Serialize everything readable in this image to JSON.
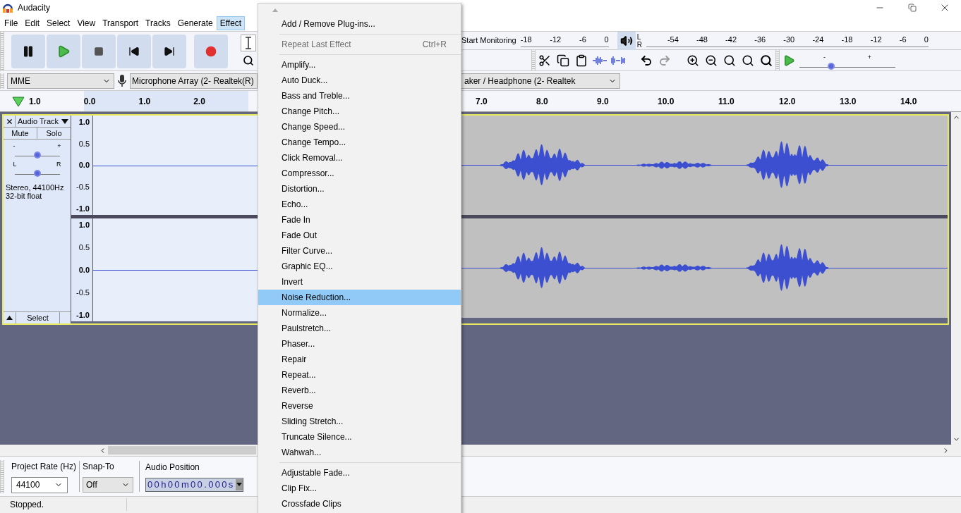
{
  "window": {
    "title": "Audacity"
  },
  "menu_bar": [
    {
      "label": "File",
      "selected": false
    },
    {
      "label": "Edit",
      "selected": false
    },
    {
      "label": "Select",
      "selected": false
    },
    {
      "label": "View",
      "selected": false
    },
    {
      "label": "Transport",
      "selected": false
    },
    {
      "label": "Tracks",
      "selected": false
    },
    {
      "label": "Generate",
      "selected": false
    },
    {
      "label": "Effect",
      "selected": true
    }
  ],
  "record_meter": {
    "button": "Start Monitoring",
    "ticks": [
      "-18",
      "-12",
      "-6",
      "0"
    ]
  },
  "playback_meter": {
    "channels": [
      "L",
      "R"
    ],
    "ticks": [
      "-54",
      "-48",
      "-42",
      "-36",
      "-30",
      "-24",
      "-18",
      "-12",
      "-6",
      "0"
    ]
  },
  "play_at_speed": {
    "min": "-",
    "max": "+",
    "level": 0.33
  },
  "device_bar": {
    "host": "MME",
    "recording_device": "Microphone Array (2- Realtek(R)",
    "playback_device": "aker / Headphone (2- Realtek"
  },
  "timeline": {
    "left_labels": [
      "1.0",
      "0.0",
      "1.0",
      "2.0"
    ],
    "right_labels": [
      "7.0",
      "8.0",
      "9.0",
      "10.0",
      "11.0",
      "12.0",
      "13.0",
      "14.0"
    ]
  },
  "track": {
    "name": "Audio Track",
    "mute": "Mute",
    "solo": "Solo",
    "gain": {
      "min": "-",
      "max": "+",
      "level": 0.5
    },
    "pan": {
      "min": "L",
      "max": "R",
      "level": 0.5
    },
    "info": [
      "Stereo, 44100Hz",
      "32-bit float"
    ],
    "select": "Select",
    "channels": [
      {
        "scale": [
          "1.0",
          "0.5",
          "0.0",
          "-0.5",
          "-1.0"
        ]
      },
      {
        "scale": [
          "1.0",
          "0.5",
          "0.0",
          "-0.5",
          "-1.0"
        ]
      }
    ]
  },
  "selection_bar": {
    "project_rate_label": "Project Rate (Hz)",
    "project_rate": "44100",
    "snap_to_label": "Snap-To",
    "snap_to": "Off",
    "audio_position_label": "Audio Position",
    "audio_position": "00h00m00.000s"
  },
  "status_bar": {
    "text": "Stopped."
  },
  "effect_menu": {
    "items": [
      {
        "kind": "item",
        "label": "Add / Remove Plug-ins...",
        "disabled": false,
        "selected": false
      },
      {
        "kind": "separator"
      },
      {
        "kind": "item",
        "label": "Repeat Last Effect",
        "shortcut": "Ctrl+R",
        "disabled": true,
        "selected": false
      },
      {
        "kind": "separator"
      },
      {
        "kind": "item",
        "label": "Amplify...",
        "disabled": false,
        "selected": false
      },
      {
        "kind": "item",
        "label": "Auto Duck...",
        "disabled": false,
        "selected": false
      },
      {
        "kind": "item",
        "label": "Bass and Treble...",
        "disabled": false,
        "selected": false
      },
      {
        "kind": "item",
        "label": "Change Pitch...",
        "disabled": false,
        "selected": false
      },
      {
        "kind": "item",
        "label": "Change Speed...",
        "disabled": false,
        "selected": false
      },
      {
        "kind": "item",
        "label": "Change Tempo...",
        "disabled": false,
        "selected": false
      },
      {
        "kind": "item",
        "label": "Click Removal...",
        "disabled": false,
        "selected": false
      },
      {
        "kind": "item",
        "label": "Compressor...",
        "disabled": false,
        "selected": false
      },
      {
        "kind": "item",
        "label": "Distortion...",
        "disabled": false,
        "selected": false
      },
      {
        "kind": "item",
        "label": "Echo...",
        "disabled": false,
        "selected": false
      },
      {
        "kind": "item",
        "label": "Fade In",
        "disabled": false,
        "selected": false
      },
      {
        "kind": "item",
        "label": "Fade Out",
        "disabled": false,
        "selected": false
      },
      {
        "kind": "item",
        "label": "Filter Curve...",
        "disabled": false,
        "selected": false
      },
      {
        "kind": "item",
        "label": "Graphic EQ...",
        "disabled": false,
        "selected": false
      },
      {
        "kind": "item",
        "label": "Invert",
        "disabled": false,
        "selected": false
      },
      {
        "kind": "item",
        "label": "Noise Reduction...",
        "disabled": false,
        "selected": true
      },
      {
        "kind": "item",
        "label": "Normalize...",
        "disabled": false,
        "selected": false
      },
      {
        "kind": "item",
        "label": "Paulstretch...",
        "disabled": false,
        "selected": false
      },
      {
        "kind": "item",
        "label": "Phaser...",
        "disabled": false,
        "selected": false
      },
      {
        "kind": "item",
        "label": "Repair",
        "disabled": false,
        "selected": false
      },
      {
        "kind": "item",
        "label": "Repeat...",
        "disabled": false,
        "selected": false
      },
      {
        "kind": "item",
        "label": "Reverb...",
        "disabled": false,
        "selected": false
      },
      {
        "kind": "item",
        "label": "Reverse",
        "disabled": false,
        "selected": false
      },
      {
        "kind": "item",
        "label": "Sliding Stretch...",
        "disabled": false,
        "selected": false
      },
      {
        "kind": "item",
        "label": "Truncate Silence...",
        "disabled": false,
        "selected": false
      },
      {
        "kind": "item",
        "label": "Wahwah...",
        "disabled": false,
        "selected": false
      },
      {
        "kind": "separator"
      },
      {
        "kind": "item",
        "label": "Adjustable Fade...",
        "disabled": false,
        "selected": false
      },
      {
        "kind": "item",
        "label": "Clip Fix...",
        "disabled": false,
        "selected": false
      },
      {
        "kind": "item",
        "label": "Crossfade Clips",
        "disabled": false,
        "selected": false
      }
    ]
  }
}
